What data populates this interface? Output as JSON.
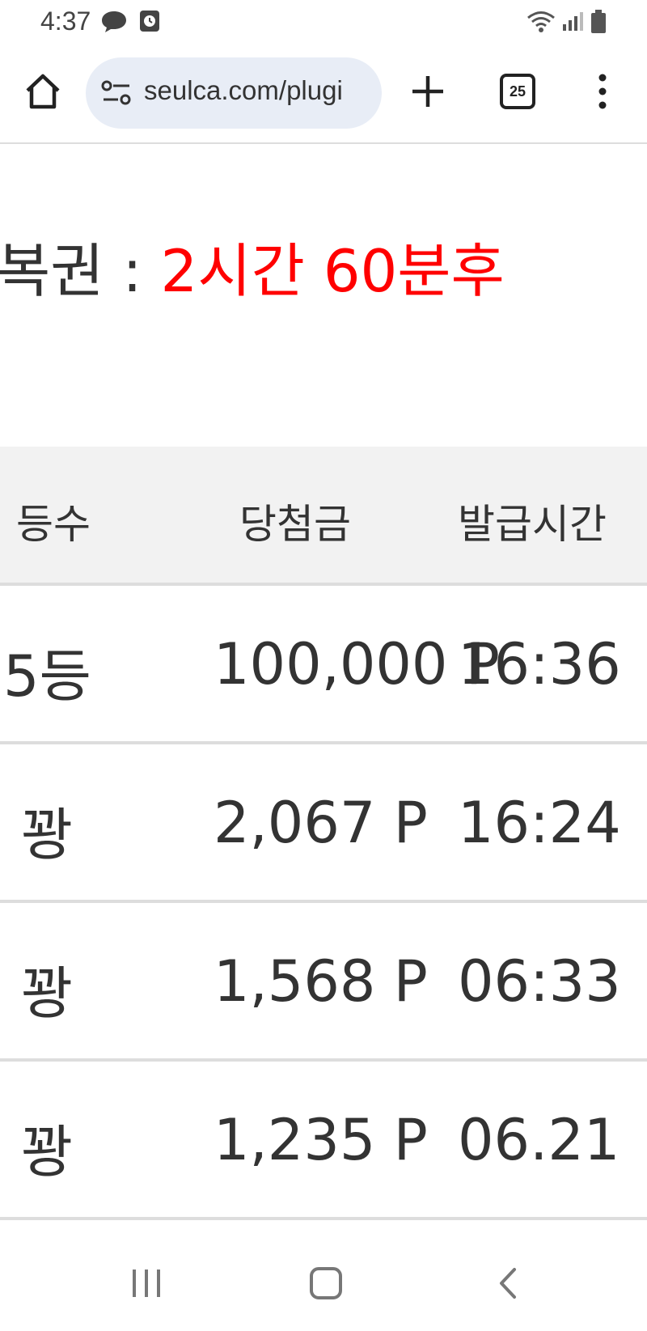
{
  "status_bar": {
    "time": "4:37",
    "icons": [
      "chat-bubble-icon",
      "clock-app-icon",
      "wifi-icon",
      "cell-signal-icon",
      "battery-icon"
    ]
  },
  "browser": {
    "url": "seulca.com/plugi",
    "tab_count": "25",
    "icons": [
      "home-icon",
      "site-info-icon",
      "plus-icon",
      "tab-switcher-icon",
      "more-vert-icon"
    ]
  },
  "page": {
    "headline_label": "복권 : ",
    "headline_value": "2시간 60분후",
    "table": {
      "headers": [
        "등수",
        "당첨금",
        "발급시간"
      ],
      "rows": [
        [
          "5등",
          "100,000 P",
          "16:36"
        ],
        [
          "꽝",
          "2,067 P",
          "16:24"
        ],
        [
          "꽝",
          "1,568 P",
          "06:33"
        ],
        [
          "꽝",
          "1,235 P",
          "06.21"
        ]
      ]
    }
  },
  "colors": {
    "accent_red": "#ff0000",
    "header_bg": "#f2f2f2",
    "url_bg": "#e8edf6",
    "divider": "#dddddd"
  },
  "nav": {
    "icons": [
      "recent-apps-icon",
      "home-nav-icon",
      "back-icon"
    ]
  }
}
